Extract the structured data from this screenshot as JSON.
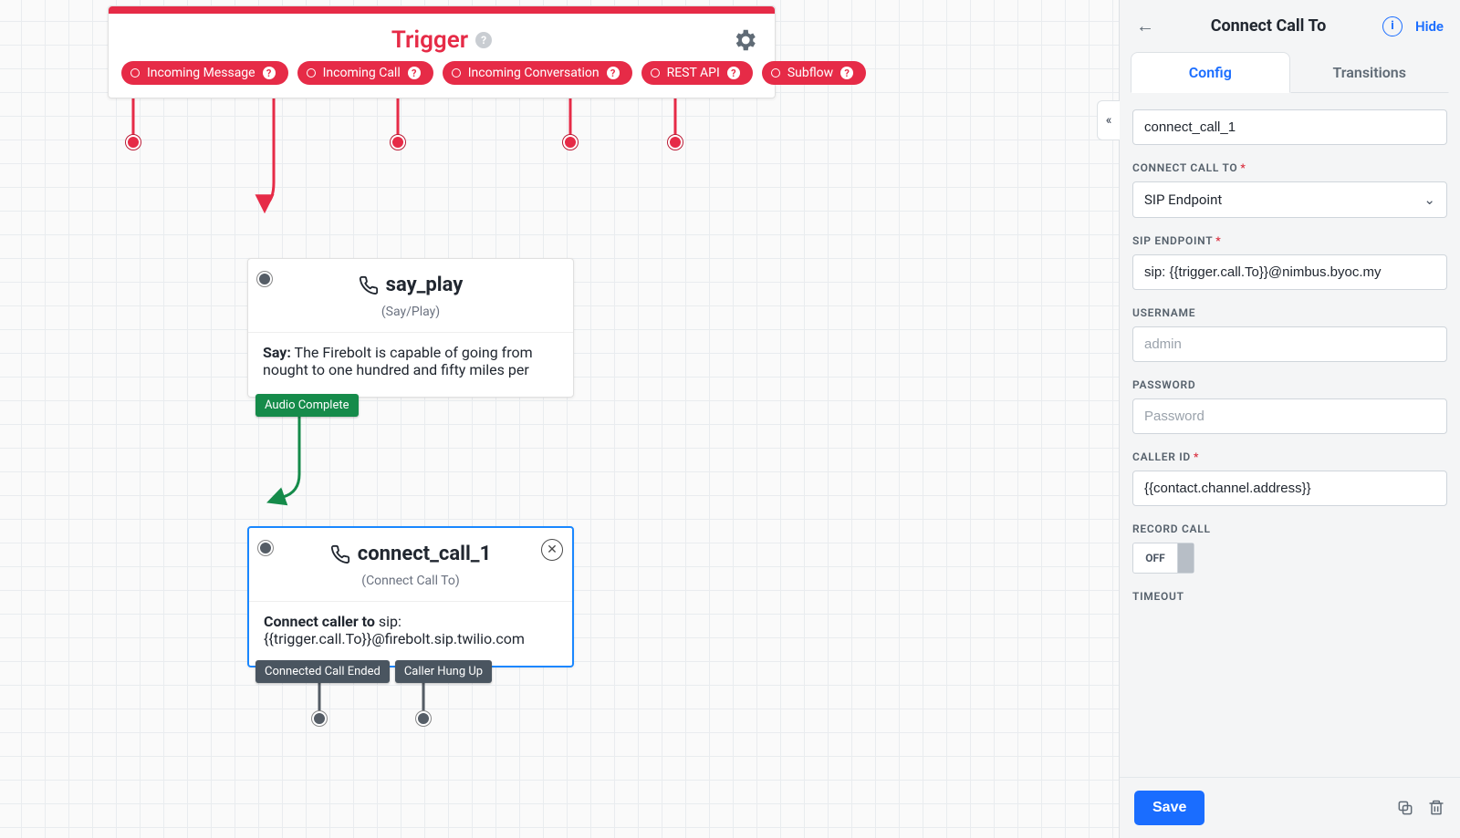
{
  "panel": {
    "title": "Connect Call To",
    "hide": "Hide",
    "tabs": {
      "config": "Config",
      "transitions": "Transitions"
    },
    "name_value": "connect_call_1",
    "connect_label": "CONNECT CALL TO",
    "connect_value": "SIP Endpoint",
    "sip_label": "SIP ENDPOINT",
    "sip_value": "sip: {{trigger.call.To}}@nimbus.byoc.my",
    "username_label": "USERNAME",
    "username_placeholder": "admin",
    "password_label": "PASSWORD",
    "password_placeholder": "Password",
    "callerid_label": "CALLER ID",
    "callerid_value": "{{contact.channel.address}}",
    "record_label": "RECORD CALL",
    "record_value": "OFF",
    "timeout_label": "TIMEOUT",
    "save": "Save"
  },
  "trigger": {
    "title": "Trigger",
    "events": [
      "Incoming Message",
      "Incoming Call",
      "Incoming Conversation",
      "REST API",
      "Subflow"
    ]
  },
  "say_node": {
    "title": "say_play",
    "sub": "(Say/Play)",
    "say_label": "Say:",
    "say_text": "The Firebolt is capable of going from nought to one hundred and fifty miles per",
    "tag": "Audio Complete"
  },
  "connect_node": {
    "title": "connect_call_1",
    "sub": "(Connect Call To)",
    "lead": "Connect caller to",
    "target": "sip:{{trigger.call.To}}@firebolt.sip.twilio.com",
    "tags": [
      "Connected Call Ended",
      "Caller Hung Up"
    ]
  }
}
